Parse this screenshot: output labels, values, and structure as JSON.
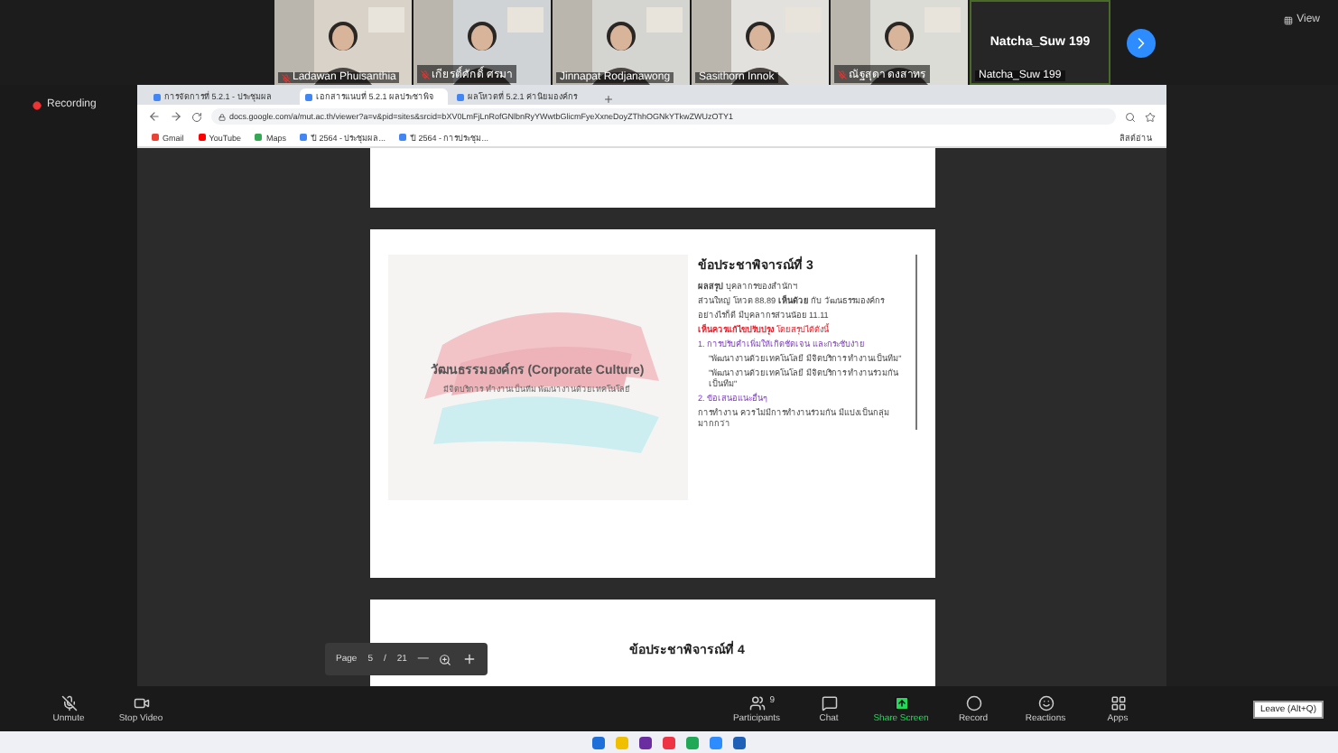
{
  "participants_strip": [
    {
      "name": "Ladawan Phuisanthia",
      "muted": true
    },
    {
      "name": "เกียรติ์ศักดิ์ ศรมา",
      "muted": true
    },
    {
      "name": "Jinnapat Rodjanawong",
      "muted": false
    },
    {
      "name": "Sasithorn Innok",
      "muted": false
    },
    {
      "name": "ณัฐสุดา ดงสาทร",
      "muted": true
    }
  ],
  "name_tile": {
    "title": "Natcha_Suw 199",
    "label": "Natcha_Suw 199"
  },
  "view_label": "View",
  "recording": "Recording",
  "browser": {
    "tabs": [
      {
        "title": "การจัดการที่ 5.2.1 - ประชุมผล",
        "selected": false
      },
      {
        "title": "เอกสารแนบที่ 5.2.1 ผลประชาพิจ",
        "selected": true
      },
      {
        "title": "ผลโหวตที่ 5.2.1 ค่านิยมองค์กร",
        "selected": false
      }
    ],
    "url": "docs.google.com/a/mut.ac.th/viewer?a=v&pid=sites&srcid=bXV0LmFjLnRofGNlbnRyYWwtbGlicmFyeXxneDoyZThhOGNkYTkwZWUzOTY1",
    "bookmarks": [
      "Gmail",
      "YouTube",
      "Maps",
      "ปี 2564 - ประชุมผล...",
      "ปี 2564 - การประชุม..."
    ],
    "reading_list": "ลิสต์อ่าน"
  },
  "slide": {
    "title": "วัฒนธรรมองค์กร (Corporate Culture)",
    "subtitle": "มีจิตบริการ ทำงานเป็นทีม พัฒนางานด้วยเทคโนโลยี"
  },
  "notes": {
    "heading": "ข้อประชาพิจารณ์ที่ 3",
    "lines": [
      {
        "kind": "plain",
        "text": "**ผลสรุป** บุคลากรของสำนักฯ"
      },
      {
        "kind": "plain",
        "text": "ส่วนใหญ่ โหวต 88.89 **เห็นด้วย** กับ วัฒนธรรมองค์กร"
      },
      {
        "kind": "plain",
        "text": "อย่างไรก็ดี มีบุคลากรส่วนน้อย 11.11"
      },
      {
        "kind": "alert",
        "text": "**เห็นควรแก้ไขปรับปรุง** โดยสรุปได้ดังนี้"
      },
      {
        "kind": "topic",
        "text": "1. การปรับคำเพิ่มให้เกิดชัดเจน และกระชับง่าย"
      },
      {
        "kind": "bullet",
        "text": "\"พัฒนางานด้วยเทคโนโลยี มีจิตบริการ ทำงานเป็นทีม\""
      },
      {
        "kind": "bullet",
        "text": "\"พัฒนางานด้วยเทคโนโลยี มีจิตบริการ ทำงานร่วมกันเป็นทีม\""
      },
      {
        "kind": "topic",
        "text": "2. ข้อเสนอแนะอื่นๆ"
      },
      {
        "kind": "plain",
        "text": "การทำงาน ควร ไม่มีการทำงานร่วมกัน มีแบ่งเป็นกลุ่มมากกว่า"
      }
    ]
  },
  "next_heading": "ข้อประชาพิจารณ์ที่ 4",
  "page_bar": {
    "label": "Page",
    "current": "5",
    "separator": "/",
    "total": "21",
    "minus": "—"
  },
  "toolbar": [
    {
      "kind": "mic",
      "label": "Unmute",
      "active": false
    },
    {
      "kind": "video",
      "label": "Stop Video",
      "active": false
    },
    {
      "kind": "people",
      "label": "Participants",
      "count": "9",
      "active": false
    },
    {
      "kind": "chat",
      "label": "Chat",
      "active": false
    },
    {
      "kind": "share",
      "label": "Share Screen",
      "active": true
    },
    {
      "kind": "record",
      "label": "Record",
      "active": false
    },
    {
      "kind": "react",
      "label": "Reactions",
      "active": false
    },
    {
      "kind": "apps",
      "label": "Apps",
      "active": false
    }
  ],
  "leave_tooltip": "Leave (Alt+Q)"
}
